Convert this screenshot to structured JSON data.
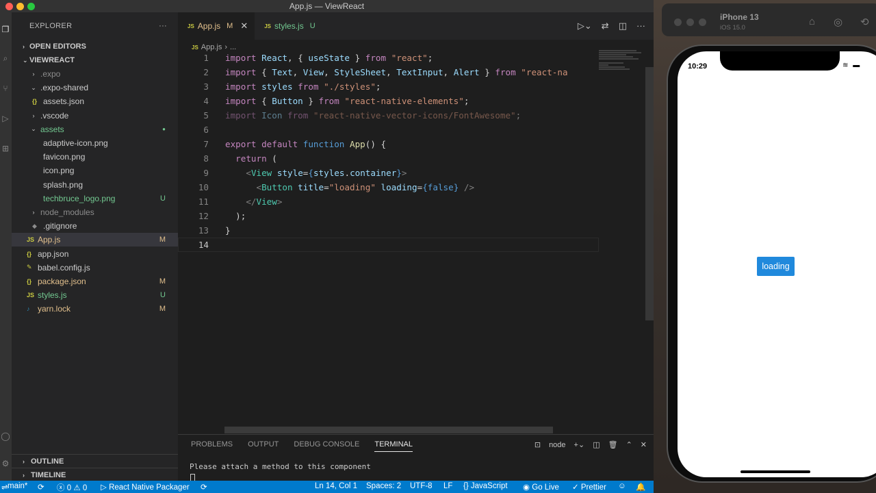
{
  "window": {
    "title": "App.js — ViewReact"
  },
  "sidebar": {
    "header": "EXPLORER",
    "more": "···",
    "open_editors": "OPEN EDITORS",
    "project": "VIEWREACT",
    "items": [
      {
        "label": ".expo",
        "badge": ""
      },
      {
        "label": ".expo-shared",
        "badge": ""
      },
      {
        "label": "assets.json",
        "badge": ""
      },
      {
        "label": ".vscode",
        "badge": ""
      },
      {
        "label": "assets",
        "badge": ""
      },
      {
        "label": "adaptive-icon.png",
        "badge": ""
      },
      {
        "label": "favicon.png",
        "badge": ""
      },
      {
        "label": "icon.png",
        "badge": ""
      },
      {
        "label": "splash.png",
        "badge": ""
      },
      {
        "label": "techbruce_logo.png",
        "badge": "U"
      },
      {
        "label": "node_modules",
        "badge": ""
      },
      {
        "label": ".gitignore",
        "badge": ""
      },
      {
        "label": "App.js",
        "badge": "M"
      },
      {
        "label": "app.json",
        "badge": ""
      },
      {
        "label": "babel.config.js",
        "badge": ""
      },
      {
        "label": "package.json",
        "badge": "M"
      },
      {
        "label": "styles.js",
        "badge": "U"
      },
      {
        "label": "yarn.lock",
        "badge": "M"
      }
    ],
    "outline": "OUTLINE",
    "timeline": "TIMELINE"
  },
  "tabs": [
    {
      "label": "App.js",
      "mark": "M"
    },
    {
      "label": "styles.js",
      "mark": "U"
    }
  ],
  "breadcrumb": {
    "file": "App.js",
    "trail": "..."
  },
  "editor": {
    "line_numbers": [
      "1",
      "2",
      "3",
      "4",
      "5",
      "6",
      "7",
      "8",
      "9",
      "10",
      "11",
      "12",
      "13",
      "14"
    ],
    "lines": [
      [
        [
          "kw",
          "import "
        ],
        [
          "id",
          "React"
        ],
        [
          "pl",
          ", { "
        ],
        [
          "id",
          "useState"
        ],
        [
          "pl",
          " } "
        ],
        [
          "kw",
          "from "
        ],
        [
          "str",
          "\"react\""
        ],
        [
          "pl",
          ";"
        ]
      ],
      [
        [
          "kw",
          "import "
        ],
        [
          "pl",
          "{ "
        ],
        [
          "id",
          "Text"
        ],
        [
          "pl",
          ", "
        ],
        [
          "id",
          "View"
        ],
        [
          "pl",
          ", "
        ],
        [
          "id",
          "StyleSheet"
        ],
        [
          "pl",
          ", "
        ],
        [
          "id",
          "TextInput"
        ],
        [
          "pl",
          ", "
        ],
        [
          "id",
          "Alert"
        ],
        [
          "pl",
          " } "
        ],
        [
          "kw",
          "from "
        ],
        [
          "str",
          "\"react-na"
        ]
      ],
      [
        [
          "kw",
          "import "
        ],
        [
          "id",
          "styles "
        ],
        [
          "kw",
          "from "
        ],
        [
          "str",
          "\"./styles\""
        ],
        [
          "pl",
          ";"
        ]
      ],
      [
        [
          "kw",
          "import "
        ],
        [
          "pl",
          "{ "
        ],
        [
          "id",
          "Button"
        ],
        [
          "pl",
          " } "
        ],
        [
          "kw",
          "from "
        ],
        [
          "str",
          "\"react-native-elements\""
        ],
        [
          "pl",
          ";"
        ]
      ],
      [
        [
          "kw faded",
          "import "
        ],
        [
          "id faded",
          "Icon "
        ],
        [
          "kw faded",
          "from "
        ],
        [
          "str faded",
          "\"react-native-vector-icons/FontAwesome\""
        ],
        [
          "pl faded",
          ";"
        ]
      ],
      [],
      [
        [
          "kw",
          "export default "
        ],
        [
          "kw2",
          "function "
        ],
        [
          "fn",
          "App"
        ],
        [
          "pl",
          "() {"
        ]
      ],
      [
        [
          "pl",
          "  "
        ],
        [
          "kw",
          "return "
        ],
        [
          "pl",
          "("
        ]
      ],
      [
        [
          "pl",
          "    "
        ],
        [
          "tagc",
          "<"
        ],
        [
          "cls",
          "View "
        ],
        [
          "id",
          "style"
        ],
        [
          "pl",
          "="
        ],
        [
          "kw2",
          "{"
        ],
        [
          "id",
          "styles"
        ],
        [
          "pl",
          "."
        ],
        [
          "id",
          "container"
        ],
        [
          "kw2",
          "}"
        ],
        [
          "tagc",
          ">"
        ]
      ],
      [
        [
          "pl",
          "      "
        ],
        [
          "tagc",
          "<"
        ],
        [
          "cls",
          "Button "
        ],
        [
          "id",
          "title"
        ],
        [
          "pl",
          "="
        ],
        [
          "str",
          "\"loading\" "
        ],
        [
          "id",
          "loading"
        ],
        [
          "pl",
          "="
        ],
        [
          "kw2",
          "{"
        ],
        [
          "bool",
          "false"
        ],
        [
          "kw2",
          "}"
        ],
        [
          "tagc",
          " />"
        ]
      ],
      [
        [
          "pl",
          "    "
        ],
        [
          "tagc",
          "</"
        ],
        [
          "cls",
          "View"
        ],
        [
          "tagc",
          ">"
        ]
      ],
      [
        [
          "pl",
          "  );"
        ]
      ],
      [
        [
          "pl",
          "}"
        ]
      ],
      []
    ]
  },
  "panel": {
    "tabs": [
      "PROBLEMS",
      "OUTPUT",
      "DEBUG CONSOLE",
      "TERMINAL"
    ],
    "active_tab": "TERMINAL",
    "terminal_name": "node",
    "terminal_text": "Please attach a method to this component"
  },
  "status": {
    "branch": "main*",
    "errors": "0",
    "warnings": "0",
    "packager": "React Native Packager",
    "position": "Ln 14, Col 1",
    "spaces": "Spaces: 2",
    "encoding": "UTF-8",
    "eol": "LF",
    "language": "JavaScript",
    "golive": "Go Live",
    "prettier": "Prettier"
  },
  "simulator": {
    "device": "iPhone 13",
    "os": "iOS 15.0",
    "time": "10:29",
    "button_label": "loading"
  },
  "colors": {
    "status_bar": "#007acc",
    "rn_button": "#2089dc",
    "modified": "#e2c08d",
    "untracked": "#73c991"
  }
}
